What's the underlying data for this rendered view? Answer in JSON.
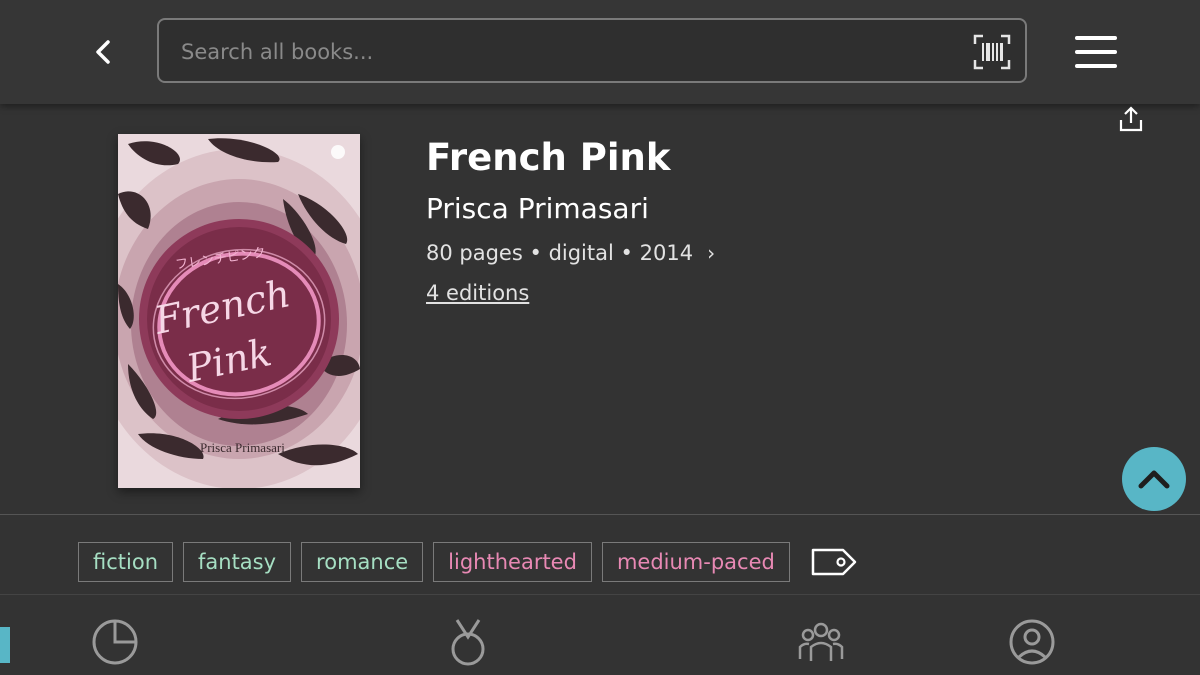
{
  "header": {
    "search_placeholder": "Search all books...",
    "icons": [
      "chevron-left-icon",
      "barcode-icon",
      "hamburger-menu-icon",
      "share-icon"
    ]
  },
  "book": {
    "title": "French Pink",
    "author": "Prisca Primasari",
    "pages": "80 pages",
    "format": "digital",
    "year": "2014",
    "separator": "•",
    "chevron": "›",
    "editions": "4 editions",
    "cover": {
      "japanese_title": "フレンチピンク",
      "title_line1": "French",
      "title_line2": "Pink",
      "author": "Prisca Primasari"
    }
  },
  "tags": {
    "genres": [
      "fiction",
      "fantasy",
      "romance"
    ],
    "moods": [
      "lighthearted",
      "medium-paced"
    ]
  },
  "nav": {
    "items": [
      "home-icon",
      "stats-icon",
      "challenges-icon",
      "community-icon",
      "profile-icon"
    ]
  },
  "colors": {
    "accent": "#58b6c6",
    "background": "#333333",
    "genre_tag": "#a6dfc3",
    "mood_tag": "#e889b4"
  }
}
